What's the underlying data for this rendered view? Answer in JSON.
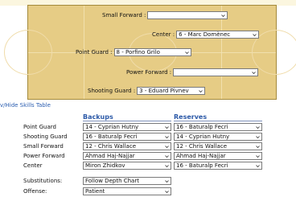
{
  "court": {
    "small_forward": {
      "label": "Small Forward :",
      "value": ""
    },
    "center": {
      "label": "Center :",
      "value": "6 - Marc Domènec"
    },
    "point_guard": {
      "label": "Point Guard :",
      "value": "8 - Porfino Grilo"
    },
    "power_forward": {
      "label": "Power Forward :",
      "value": ""
    },
    "shooting_guard": {
      "label": "Shooting Guard :",
      "value": "3 - Eduard Pivnev"
    }
  },
  "skills_link": "v/Hide Skills Table",
  "depth": {
    "backups_header": "Backups",
    "reserves_header": "Reserves",
    "rows": [
      {
        "label": "Point Guard",
        "backup": "14 - Cyprian Hutny",
        "reserve": "16 - Baturalp Fecri"
      },
      {
        "label": "Shooting Guard",
        "backup": "16 - Baturalp Fecri",
        "reserve": "14 - Cyprian Hutny"
      },
      {
        "label": "Small Forward",
        "backup": "12 - Chris Wallace",
        "reserve": "12 - Chris Wallace"
      },
      {
        "label": "Power Forward",
        "backup": "Ahmad Haj-Najjar",
        "reserve": "Ahmad Haj-Najjar"
      },
      {
        "label": "Center",
        "backup": "Miron Zhidkov",
        "reserve": "16 - Baturalp Fecri"
      }
    ],
    "substitutions": {
      "label": "Substitutions:",
      "value": "Follow Depth Chart"
    },
    "offense": {
      "label": "Offense:",
      "value": "Patient"
    }
  },
  "icons": {
    "dropdown": "chevron-down-icon"
  }
}
